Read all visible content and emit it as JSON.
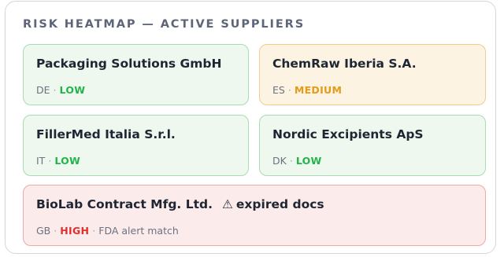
{
  "panel": {
    "title": "RISK HEATMAP — ACTIVE SUPPLIERS"
  },
  "suppliers": [
    {
      "name": "Packaging Solutions GmbH",
      "country": "DE",
      "risk": "LOW"
    },
    {
      "name": "ChemRaw Iberia S.A.",
      "country": "ES",
      "risk": "MEDIUM"
    },
    {
      "name": "FillerMed Italia S.r.l.",
      "country": "IT",
      "risk": "LOW"
    },
    {
      "name": "Nordic Excipients ApS",
      "country": "DK",
      "risk": "LOW"
    },
    {
      "name": "BioLab Contract Mfg. Ltd.",
      "country": "GB",
      "risk": "HIGH",
      "flag": "expired docs",
      "note": "FDA alert match"
    }
  ],
  "separator": "·",
  "icons": {
    "flag": "warning-icon"
  },
  "colors": {
    "low": "#22b44a",
    "medium": "#e49b17",
    "high": "#e02f2f"
  }
}
